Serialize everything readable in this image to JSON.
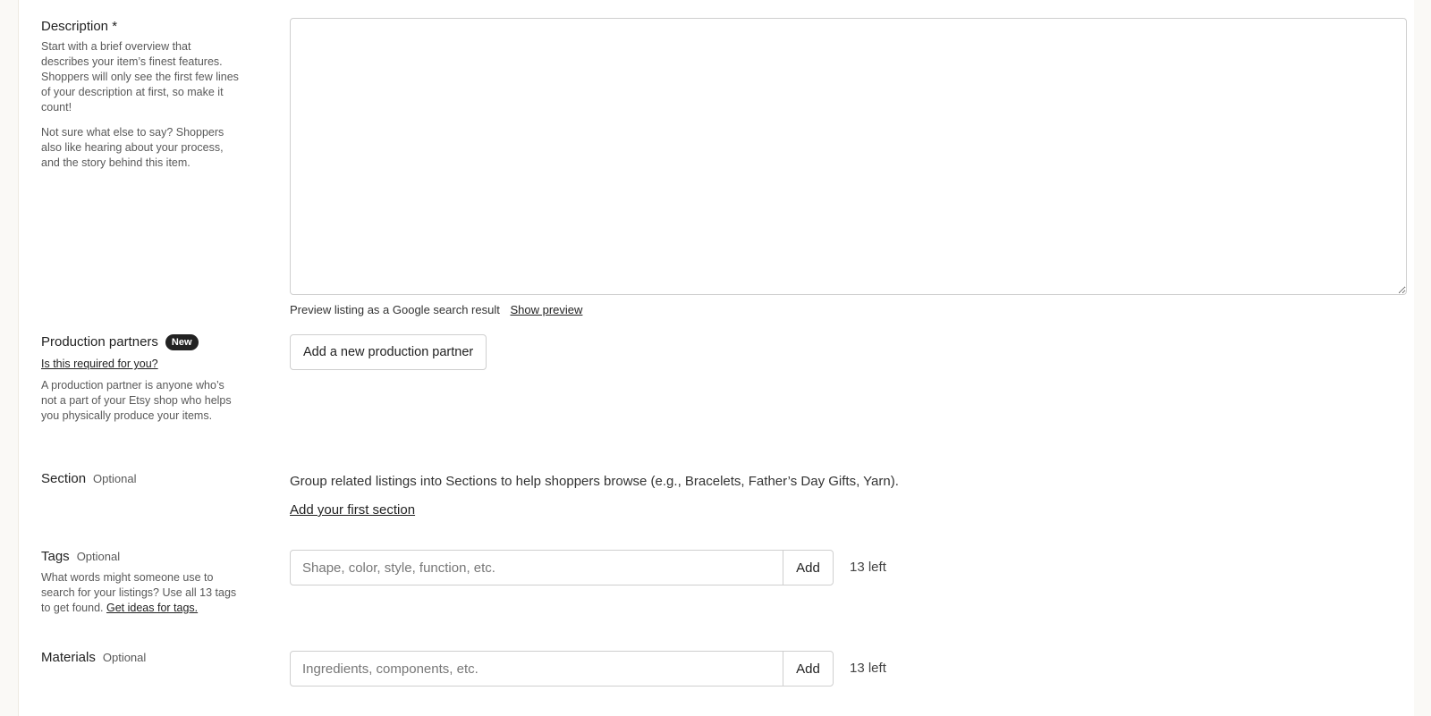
{
  "description": {
    "title": "Description *",
    "help_1": "Start with a brief overview that describes your item’s finest features. Shoppers will only see the first few lines of your description at first, so make it count!",
    "help_2": "Not sure what else to say? Shoppers also like hearing about your process, and the story behind this item.",
    "value": "",
    "preview_text": "Preview listing as a Google search result",
    "preview_link": "Show preview"
  },
  "production_partners": {
    "title": "Production partners",
    "badge": "New",
    "required_link": "Is this required for you?",
    "help": "A production partner is anyone who’s not a part of your Etsy shop who helps you physically produce your items.",
    "button_label": "Add a new production partner"
  },
  "section": {
    "title": "Section",
    "optional": "Optional",
    "text": "Group related listings into Sections to help shoppers browse (e.g., Bracelets, Father’s Day Gifts, Yarn).",
    "link": "Add your first section"
  },
  "tags": {
    "title": "Tags",
    "optional": "Optional",
    "help": "What words might someone use to search for your listings? Use all 13 tags to get found.",
    "help_link": "Get ideas for tags.",
    "placeholder": "Shape, color, style, function, etc.",
    "add_label": "Add",
    "count": "13 left"
  },
  "materials": {
    "title": "Materials",
    "optional": "Optional",
    "placeholder": "Ingredients, components, etc.",
    "add_label": "Add",
    "count": "13 left"
  }
}
